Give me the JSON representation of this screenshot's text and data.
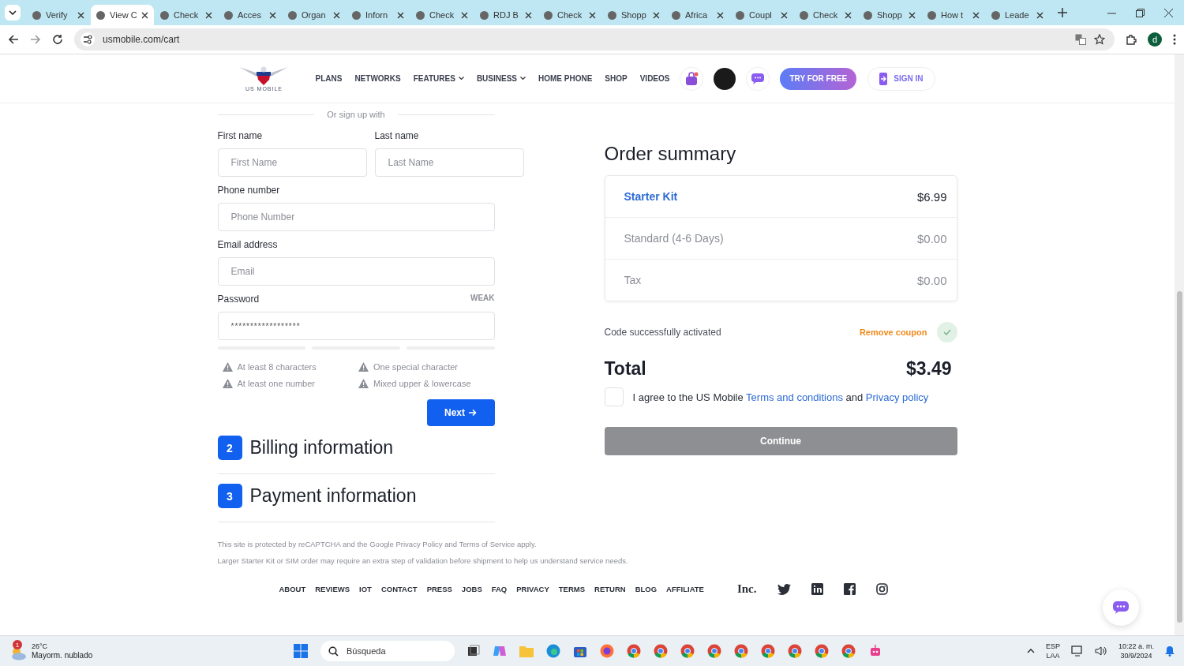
{
  "browser": {
    "tabs": [
      {
        "label": "Verify",
        "selected": false
      },
      {
        "label": "View C",
        "selected": true
      },
      {
        "label": "Check",
        "selected": false
      },
      {
        "label": "Acces",
        "selected": false
      },
      {
        "label": "Organ",
        "selected": false
      },
      {
        "label": "Inforn",
        "selected": false
      },
      {
        "label": "Check",
        "selected": false
      },
      {
        "label": "RDJ B",
        "selected": false
      },
      {
        "label": "Check",
        "selected": false
      },
      {
        "label": "Shopp",
        "selected": false
      },
      {
        "label": "Africa",
        "selected": false
      },
      {
        "label": "Coupl",
        "selected": false
      },
      {
        "label": "Check",
        "selected": false
      },
      {
        "label": "Shopp",
        "selected": false
      },
      {
        "label": "How t",
        "selected": false
      },
      {
        "label": "Leade",
        "selected": false
      }
    ],
    "url": "usmobile.com/cart",
    "profile_initial": "d"
  },
  "header": {
    "logo": "US MOBILE",
    "nav": [
      {
        "label": "PLANS",
        "dropdown": false
      },
      {
        "label": "NETWORKS",
        "dropdown": false
      },
      {
        "label": "FEATURES",
        "dropdown": true
      },
      {
        "label": "BUSINESS",
        "dropdown": true
      },
      {
        "label": "HOME PHONE",
        "dropdown": false
      },
      {
        "label": "SHOP",
        "dropdown": false
      },
      {
        "label": "VIDEOS",
        "dropdown": false
      }
    ],
    "try_button": "TRY FOR FREE",
    "sign_in": "SIGN IN"
  },
  "form": {
    "divider_text": "Or sign up with",
    "first_name": {
      "label": "First name",
      "placeholder": "First Name"
    },
    "last_name": {
      "label": "Last name",
      "placeholder": "Last Name"
    },
    "phone": {
      "label": "Phone number",
      "placeholder": "Phone Number"
    },
    "email": {
      "label": "Email address",
      "placeholder": "Email"
    },
    "password": {
      "label": "Password",
      "strength": "WEAK",
      "value": "******************"
    },
    "requirements": [
      {
        "text": "At least 8 characters",
        "met": false
      },
      {
        "text": "One special character",
        "met": false
      },
      {
        "text": "At least one number",
        "met": false
      },
      {
        "text": "Mixed upper & lowercase",
        "met": false
      }
    ],
    "next_button": "Next"
  },
  "sections": [
    {
      "number": "2",
      "title": "Billing information"
    },
    {
      "number": "3",
      "title": "Payment information"
    }
  ],
  "order_summary": {
    "title": "Order summary",
    "items": [
      {
        "name": "Starter Kit",
        "price": "$6.99",
        "kind": "link"
      },
      {
        "name": "Standard (4-6 Days)",
        "price": "$0.00",
        "kind": "plain"
      },
      {
        "name": "Tax",
        "price": "$0.00",
        "kind": "plain"
      }
    ],
    "coupon_status": "Code successfully activated",
    "remove_coupon": "Remove coupon",
    "total_label": "Total",
    "total": "$3.49",
    "agree": {
      "checked": false,
      "text": "I agree to the US Mobile",
      "terms": "Terms and conditions",
      "and": "and",
      "privacy": "Privacy policy"
    },
    "continue_button": {
      "label": "Continue",
      "disabled": true
    }
  },
  "notes": [
    "This site is protected by reCAPTCHA and the Google Privacy Policy and Terms of Service apply.",
    "Larger Starter Kit or SIM order may require an extra step of validation before shipment to help us understand service needs."
  ],
  "footer": {
    "links": [
      "ABOUT",
      "REVIEWS",
      "IOT",
      "CONTACT",
      "PRESS",
      "JOBS",
      "FAQ",
      "PRIVACY",
      "TERMS",
      "RETURN",
      "BLOG",
      "AFFILIATE"
    ],
    "inc_logo": "Inc."
  },
  "taskbar": {
    "weather": {
      "badge": "1",
      "temp": "26°C",
      "desc": "Mayorm. nublado"
    },
    "search": "Búsqueda",
    "lang": "ESP",
    "layout": "LAA",
    "time": "10:22 a. m.",
    "date": "30/9/2024"
  }
}
